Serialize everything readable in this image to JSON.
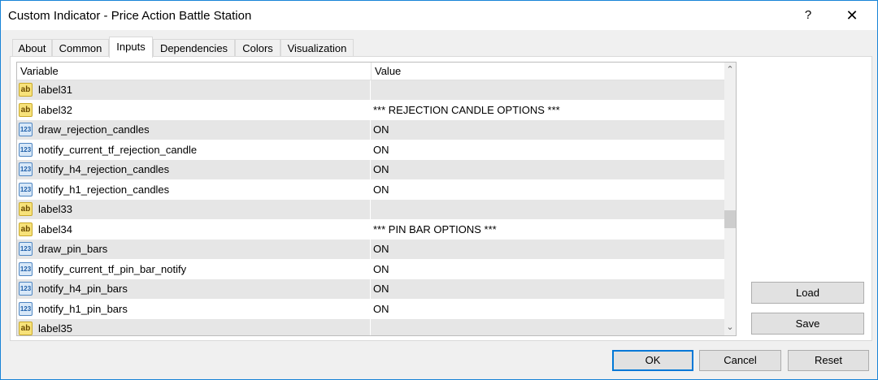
{
  "window": {
    "title": "Custom Indicator - Price Action Battle Station",
    "help_label": "?",
    "close_label": "✕"
  },
  "tabs": [
    {
      "label": "About"
    },
    {
      "label": "Common"
    },
    {
      "label": "Inputs",
      "active": true
    },
    {
      "label": "Dependencies"
    },
    {
      "label": "Colors"
    },
    {
      "label": "Visualization"
    }
  ],
  "grid": {
    "headers": {
      "variable": "Variable",
      "value": "Value"
    },
    "rows": [
      {
        "icon": "text-param-icon",
        "icon_glyph": "ab",
        "variable": "label31",
        "value": ""
      },
      {
        "icon": "text-param-icon",
        "icon_glyph": "ab",
        "variable": "label32",
        "value": "*** REJECTION CANDLE OPTIONS ***"
      },
      {
        "icon": "numeric-param-icon",
        "icon_glyph": "123",
        "variable": "draw_rejection_candles",
        "value": "ON"
      },
      {
        "icon": "numeric-param-icon",
        "icon_glyph": "123",
        "variable": "notify_current_tf_rejection_candle",
        "value": "ON"
      },
      {
        "icon": "numeric-param-icon",
        "icon_glyph": "123",
        "variable": "notify_h4_rejection_candles",
        "value": "ON"
      },
      {
        "icon": "numeric-param-icon",
        "icon_glyph": "123",
        "variable": "notify_h1_rejection_candles",
        "value": "ON"
      },
      {
        "icon": "text-param-icon",
        "icon_glyph": "ab",
        "variable": "label33",
        "value": ""
      },
      {
        "icon": "text-param-icon",
        "icon_glyph": "ab",
        "variable": "label34",
        "value": "*** PIN BAR OPTIONS ***"
      },
      {
        "icon": "numeric-param-icon",
        "icon_glyph": "123",
        "variable": "draw_pin_bars",
        "value": "ON"
      },
      {
        "icon": "numeric-param-icon",
        "icon_glyph": "123",
        "variable": "notify_current_tf_pin_bar_notify",
        "value": "ON"
      },
      {
        "icon": "numeric-param-icon",
        "icon_glyph": "123",
        "variable": "notify_h4_pin_bars",
        "value": "ON"
      },
      {
        "icon": "numeric-param-icon",
        "icon_glyph": "123",
        "variable": "notify_h1_pin_bars",
        "value": "ON"
      },
      {
        "icon": "text-param-icon",
        "icon_glyph": "ab",
        "variable": "label35",
        "value": ""
      }
    ],
    "scroll_up_glyph": "⌃",
    "scroll_down_glyph": "⌄"
  },
  "side_buttons": {
    "load": "Load",
    "save": "Save"
  },
  "footer": {
    "ok": "OK",
    "cancel": "Cancel",
    "reset": "Reset"
  },
  "colors": {
    "window_border": "#1883d7",
    "accent": "#0078d7",
    "row_shade": "#e6e6e6"
  }
}
